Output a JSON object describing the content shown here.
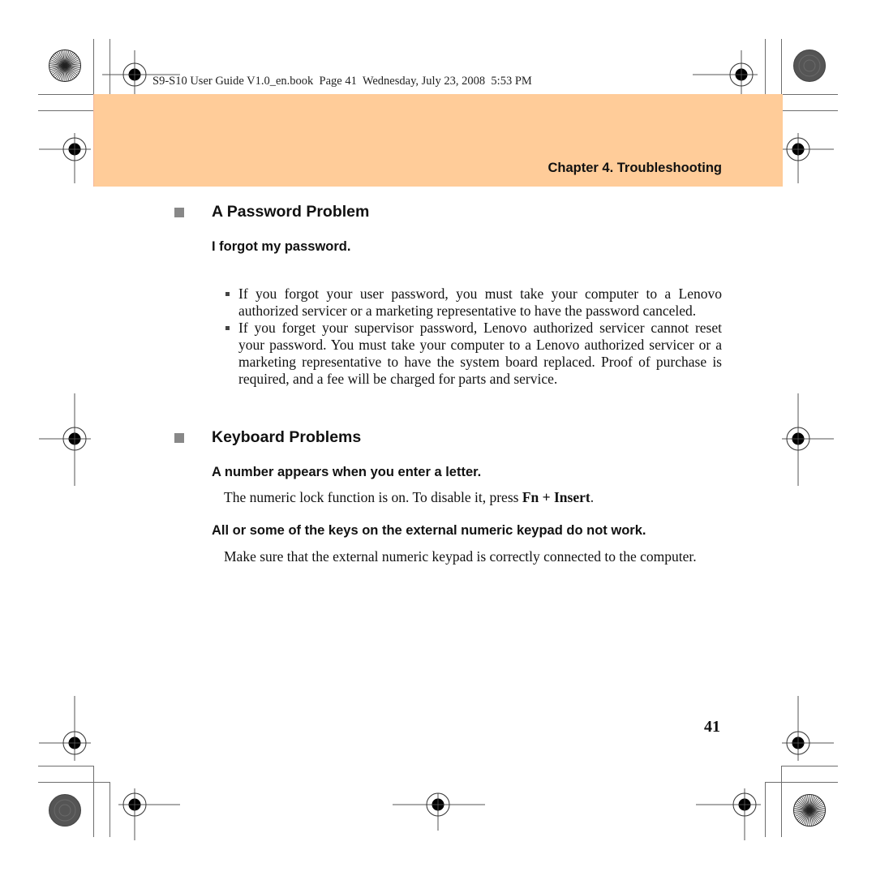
{
  "print_slug": "S9-S10 User Guide V1.0_en.book  Page 41  Wednesday, July 23, 2008  5:53 PM",
  "header": {
    "chapter_title": "Chapter 4. Troubleshooting",
    "band_color": "#ffcc99"
  },
  "sections": [
    {
      "title": "A Password Problem",
      "subsections": [
        {
          "title": "I forgot my password.",
          "bullets": [
            "If you forgot your user password, you must take your computer to a Lenovo authorized servicer or a marketing representative to have the password canceled.",
            "If you forget your supervisor password, Lenovo authorized servicer cannot reset your password. You must take your computer to a Lenovo authorized servicer or a marketing representative to have the system board replaced. Proof of purchase is required, and a fee will be charged for parts and service."
          ]
        }
      ]
    },
    {
      "title": "Keyboard Problems",
      "subsections": [
        {
          "title": "A number appears when you enter a letter.",
          "text_before": "The numeric lock function is on. To disable it, press ",
          "key_combo": "Fn + Insert",
          "text_after": "."
        },
        {
          "title": "All or some of the keys on the external numeric keypad do not work.",
          "text": "Make sure that the external numeric keypad is correctly connected to the computer."
        }
      ]
    }
  ],
  "page_number": "41",
  "icons": {
    "registration_mark": "crosshair-registration-mark",
    "star_target": "radial-star-target",
    "gray_disc": "gray-moire-disc"
  }
}
